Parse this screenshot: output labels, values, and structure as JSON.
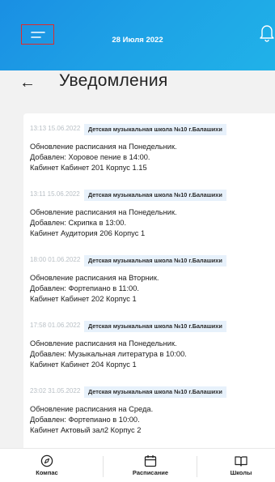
{
  "header": {
    "date": "28 Июля 2022",
    "menu_icon": "menu-icon",
    "bell_icon": "bell-icon",
    "gradient_colors": [
      "#1a8fe3",
      "#20b2e8"
    ]
  },
  "page": {
    "title": "Уведомления",
    "back_icon": "arrow-left-icon",
    "back_glyph": "←"
  },
  "notifications": [
    {
      "time": "13:13 15.06.2022",
      "school": "Детская музыкальная школа №10 г.Балашихи",
      "lines": [
        "Обновление расписания на Понедельник.",
        "Добавлен: Хоровое пение в 14:00.",
        "Кабинет Кабинет 201 Корпус 1.15"
      ]
    },
    {
      "time": "13:11 15.06.2022",
      "school": "Детская музыкальная школа №10 г.Балашихи",
      "lines": [
        "Обновление расписания на Понедельник.",
        "Добавлен: Скрипка в 13:00.",
        "Кабинет Аудитория 206 Корпус 1"
      ]
    },
    {
      "time": "18:00 01.06.2022",
      "school": "Детская музыкальная школа №10 г.Балашихи",
      "lines": [
        "Обновление расписания на Вторник.",
        "Добавлен: Фортепиано в 11:00.",
        "Кабинет Кабинет 202 Корпус 1"
      ]
    },
    {
      "time": "17:58 01.06.2022",
      "school": "Детская музыкальная школа №10 г.Балашихи",
      "lines": [
        "Обновление расписания на Понедельник.",
        "Добавлен: Музыкальная литература в 10:00.",
        "Кабинет Кабинет 204 Корпус 1"
      ]
    },
    {
      "time": "23:02 31.05.2022",
      "school": "Детская музыкальная школа №10 г.Балашихи",
      "lines": [
        "Обновление расписания на Среда.",
        "Добавлен: Фортепиано в 10:00.",
        "Кабинет Актовый зал2 Корпус 2"
      ]
    }
  ],
  "bottom_nav": [
    {
      "label": "Компас",
      "icon": "compass-icon"
    },
    {
      "label": "Расписание",
      "icon": "calendar-icon"
    },
    {
      "label": "Школы",
      "icon": "book-icon"
    }
  ]
}
